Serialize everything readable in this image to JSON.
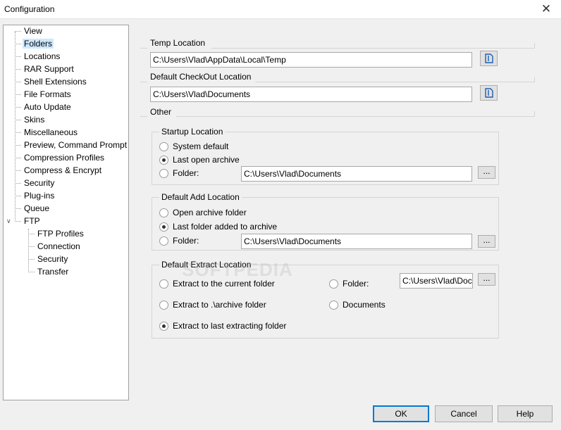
{
  "window": {
    "title": "Configuration",
    "close_glyph": "✕"
  },
  "tree": {
    "items": [
      {
        "label": "View"
      },
      {
        "label": "Folders",
        "selected": true
      },
      {
        "label": "Locations"
      },
      {
        "label": "RAR Support"
      },
      {
        "label": "Shell Extensions"
      },
      {
        "label": "File Formats"
      },
      {
        "label": "Auto Update"
      },
      {
        "label": "Skins"
      },
      {
        "label": "Miscellaneous"
      },
      {
        "label": "Preview, Command Prompt"
      },
      {
        "label": "Compression Profiles"
      },
      {
        "label": "Compress & Encrypt"
      },
      {
        "label": "Security"
      },
      {
        "label": "Plug-ins"
      },
      {
        "label": "Queue"
      },
      {
        "label": "FTP",
        "expanded": true
      }
    ],
    "ftp_children": [
      {
        "label": "FTP Profiles"
      },
      {
        "label": "Connection"
      },
      {
        "label": "Security"
      },
      {
        "label": "Transfer"
      }
    ]
  },
  "temp_location": {
    "title": "Temp Location",
    "value": "C:\\Users\\Vlad\\AppData\\Local\\Temp"
  },
  "checkout_location": {
    "title": "Default CheckOut Location",
    "value": "C:\\Users\\Vlad\\Documents"
  },
  "other": {
    "title": "Other"
  },
  "startup_location": {
    "title": "Startup Location",
    "options": [
      "System default",
      "Last open archive",
      "Folder:"
    ],
    "selected": 1,
    "folder_value": "C:\\Users\\Vlad\\Documents",
    "browse_label": "..."
  },
  "add_location": {
    "title": "Default Add Location",
    "options": [
      "Open archive folder",
      "Last folder added to archive",
      "Folder:"
    ],
    "selected": 1,
    "folder_value": "C:\\Users\\Vlad\\Documents",
    "browse_label": "..."
  },
  "extract_location": {
    "title": "Default Extract Location",
    "options": [
      "Extract to the current folder",
      "Extract to .\\archive folder",
      "Extract to last extracting folder",
      "Folder:",
      "Documents"
    ],
    "selected": 2,
    "folder_value": "C:\\Users\\Vlad\\Documents",
    "browse_label": "..."
  },
  "watermark": "SOFTPEDIA",
  "buttons": {
    "ok": "OK",
    "cancel": "Cancel",
    "help": "Help"
  },
  "colors": {
    "selection": "#cce8ff",
    "default_button_border": "#0078d7"
  }
}
